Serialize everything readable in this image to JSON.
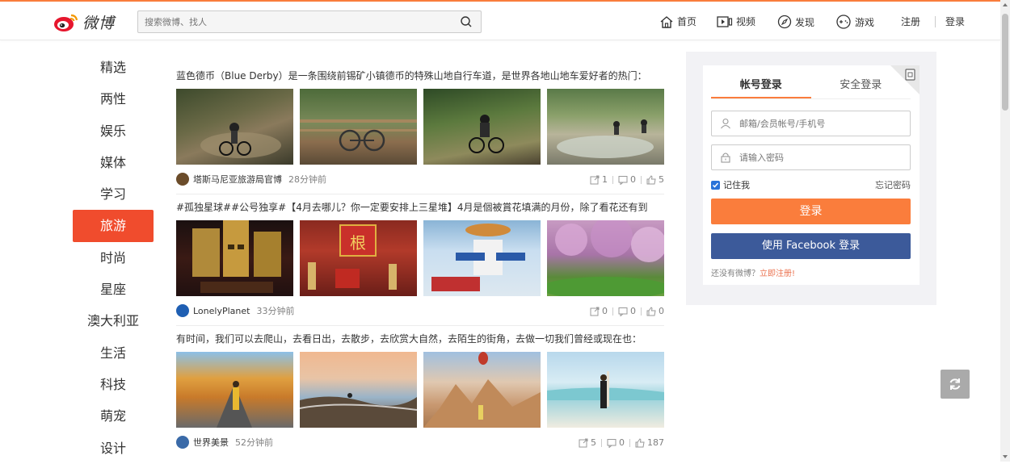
{
  "colors": {
    "accent": "#fa7d3c",
    "active_nav": "#f04c2d",
    "facebook": "#3c5a9a",
    "link": "#eb7350"
  },
  "header": {
    "logo_text": "微博",
    "search_placeholder": "搜索微博、找人",
    "nav": {
      "home": "首页",
      "video": "视频",
      "discover": "发现",
      "game": "游戏",
      "register": "注册",
      "login": "登录"
    }
  },
  "sidebar": {
    "items": [
      {
        "label": "精选"
      },
      {
        "label": "两性"
      },
      {
        "label": "娱乐"
      },
      {
        "label": "媒体"
      },
      {
        "label": "学习"
      },
      {
        "label": "旅游",
        "active": true
      },
      {
        "label": "时尚"
      },
      {
        "label": "星座"
      },
      {
        "label": "澳大利亚"
      },
      {
        "label": "生活"
      },
      {
        "label": "科技"
      },
      {
        "label": "萌宠"
      },
      {
        "label": "设计"
      }
    ]
  },
  "feed": {
    "posts": [
      {
        "title": "蓝色德币（Blue Derby）是一条围绕前锡矿小镇德币的特殊山地自行车道，是世界各地山地车爱好者的热门：",
        "author": "塔斯马尼亚旅游局官博",
        "time": "28分钟前",
        "reposts": "1",
        "comments": "0",
        "likes": "5"
      },
      {
        "title": "#孤独星球##公号独享#【4月去哪儿？你一定要安排上三星堆】4月是個被賞花填满的月份，除了看花还有到",
        "author": "LonelyPlanet",
        "time": "33分钟前",
        "reposts": "0",
        "comments": "0",
        "likes": "0"
      },
      {
        "title": "有时间，我们可以去爬山，去看日出，去散步，去欣赏大自然，去陌生的街角，去做一切我们曾经或现在也：",
        "author": "世界美景",
        "time": "52分钟前",
        "reposts": "5",
        "comments": "0",
        "likes": "187"
      }
    ]
  },
  "login": {
    "tab_account": "帐号登录",
    "tab_secure": "安全登录",
    "username_placeholder": "邮箱/会员帐号/手机号",
    "password_placeholder": "请输入密码",
    "remember": "记住我",
    "forgot": "忘记密码",
    "login_button": "登录",
    "facebook_button": "使用 Facebook 登录",
    "no_account": "还没有微博？",
    "register_now": "立即注册!"
  }
}
